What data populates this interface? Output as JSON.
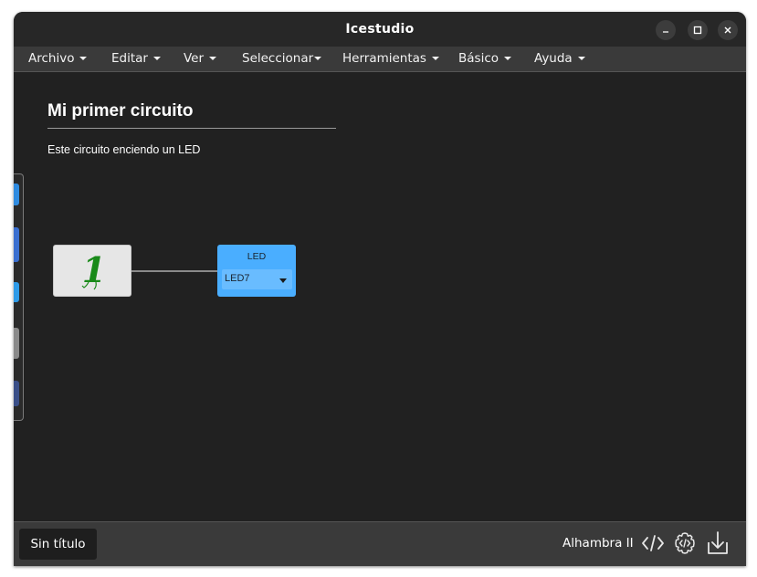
{
  "window": {
    "title": "Icestudio"
  },
  "menu": {
    "items": [
      {
        "label": "Archivo"
      },
      {
        "label": "Editar"
      },
      {
        "label": "Ver"
      },
      {
        "label": "Seleccionar"
      },
      {
        "label": "Herramientas"
      },
      {
        "label": "Básico"
      },
      {
        "label": "Ayuda"
      }
    ]
  },
  "canvas": {
    "title": "Mi primer circuito",
    "description": "Este circuito enciendo un LED",
    "constant_block": {
      "value": "1"
    },
    "led_block": {
      "label": "LED",
      "selected": "LED7"
    }
  },
  "footer": {
    "file_name": "Sin título",
    "board": "Alhambra II"
  },
  "icons": [
    "minimize-icon",
    "maximize-icon",
    "close-icon",
    "code-icon",
    "gear-code-icon",
    "download-icon"
  ],
  "colors": {
    "canvas_bg": "#212121",
    "led_block": "#4aaeff",
    "constant_text": "#1a8a1a"
  }
}
